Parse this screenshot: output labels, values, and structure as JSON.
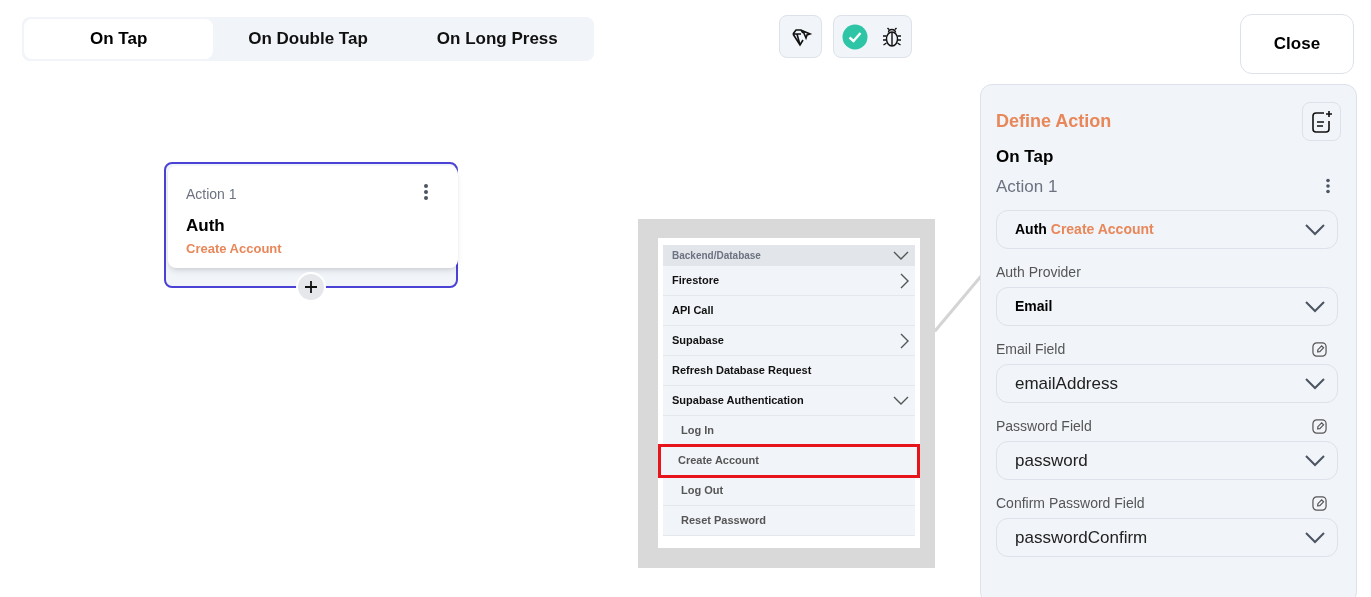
{
  "tabs": [
    {
      "label": "On Tap",
      "selected": true
    },
    {
      "label": "On Double Tap",
      "selected": false
    },
    {
      "label": "On Long Press",
      "selected": false
    }
  ],
  "toolbar": {
    "validation_ok": true
  },
  "close_button": "Close",
  "node": {
    "title": "Action 1",
    "action": "Auth",
    "subaction": "Create Account",
    "selected": true
  },
  "reference_screenshot": {
    "items": [
      {
        "label": "Backend/Database",
        "kind": "header",
        "expandable": true,
        "expanded": true,
        "highlighted": false
      },
      {
        "label": "Firestore",
        "kind": "item",
        "expandable": true,
        "expanded": false,
        "highlighted": false
      },
      {
        "label": "API Call",
        "kind": "item",
        "expandable": false,
        "highlighted": false
      },
      {
        "label": "Supabase",
        "kind": "item",
        "expandable": true,
        "expanded": false,
        "highlighted": false
      },
      {
        "label": "Refresh Database Request",
        "kind": "item",
        "expandable": false,
        "highlighted": false
      },
      {
        "label": "Supabase Authentication",
        "kind": "item",
        "expandable": true,
        "expanded": true,
        "highlighted": false
      },
      {
        "label": "Log In",
        "kind": "subitem",
        "expandable": false,
        "highlighted": false
      },
      {
        "label": "Create Account",
        "kind": "subitem",
        "expandable": false,
        "highlighted": true
      },
      {
        "label": "Log Out",
        "kind": "subitem",
        "expandable": false,
        "highlighted": false
      },
      {
        "label": "Reset Password",
        "kind": "subitem",
        "expandable": false,
        "highlighted": false
      }
    ]
  },
  "panel": {
    "title": "Define Action",
    "trigger": "On Tap",
    "action_title": "Action 1",
    "action_select": {
      "category": "Auth",
      "value": "Create Account"
    },
    "fields": [
      {
        "label": "Auth Provider",
        "value": "Email",
        "kind": "option",
        "editable": false
      },
      {
        "label": "Email Field",
        "value": "emailAddress",
        "kind": "variable",
        "editable": true
      },
      {
        "label": "Password Field",
        "value": "password",
        "kind": "variable",
        "editable": true
      },
      {
        "label": "Confirm Password Field",
        "value": "passwordConfirm",
        "kind": "variable",
        "editable": true
      }
    ]
  }
}
